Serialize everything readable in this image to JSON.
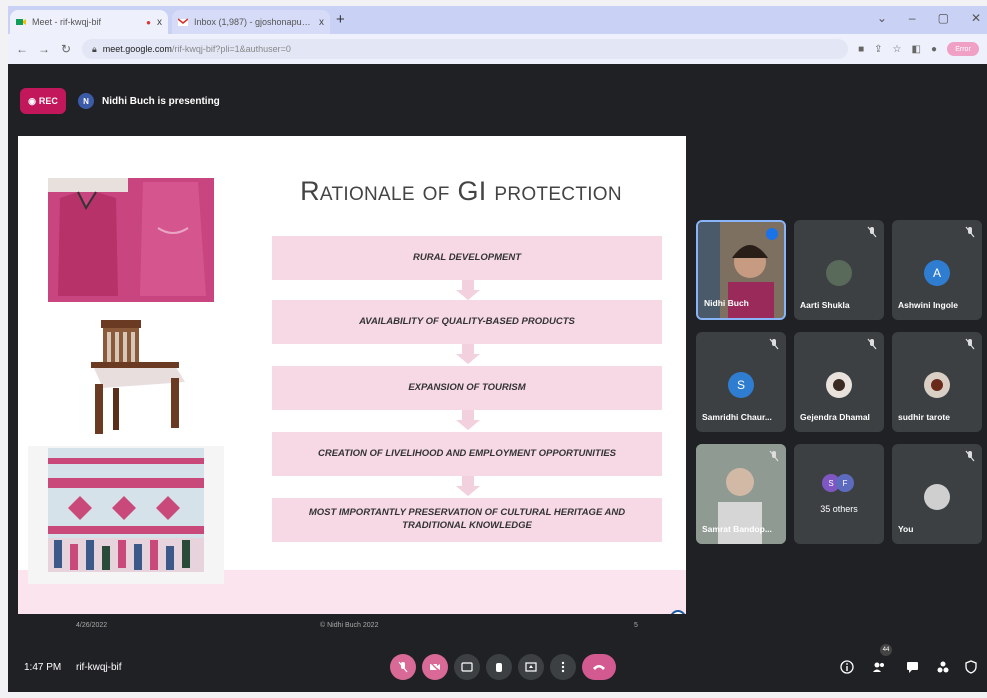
{
  "browser": {
    "tabs": [
      {
        "title": "Meet - rif-kwqj-bif",
        "recording": "●",
        "close": "x"
      },
      {
        "title": "Inbox (1,987) - gjoshonapune@...",
        "close": "x"
      }
    ],
    "new_tab": "+",
    "address": {
      "host": "meet.google.com",
      "path": "/rif-kwqj-bif?pli=1&authuser=0"
    },
    "profile_label": "Error"
  },
  "meet": {
    "rec_label": "REC",
    "presenter_initial": "N",
    "presenting_text": "Nidhi Buch is presenting",
    "slide": {
      "title": "Rationale of GI protection",
      "steps": [
        "RURAL DEVELOPMENT",
        "AVAILABILITY OF QUALITY-BASED PRODUCTS",
        "EXPANSION OF TOURISM",
        "CREATION OF LIVELIHOOD AND EMPLOYMENT OPPORTUNITIES",
        "MOST IMPORTANTLY PRESERVATION OF CULTURAL HERITAGE AND TRADITIONAL KNOWLEDGE"
      ],
      "footer_date": "4/26/2022",
      "footer_copyright": "© Nidhi Buch 2022",
      "footer_page": "5"
    },
    "participants": [
      {
        "name": "Nidhi Buch"
      },
      {
        "name": "Aarti Shukla"
      },
      {
        "name": "Ashwini Ingole",
        "initial": "A"
      },
      {
        "name": "Samridhi Chaur...",
        "initial": "S"
      },
      {
        "name": "Gejendra Dhamal"
      },
      {
        "name": "sudhir tarote"
      },
      {
        "name": "Samrat Bandop..."
      },
      {
        "name": "35 others",
        "initials": [
          "S",
          "F"
        ]
      },
      {
        "name": "You"
      }
    ],
    "bottom": {
      "time": "1:47 PM",
      "code": "rif-kwqj-bif",
      "people_count": "44"
    },
    "colors": {
      "rec": "#c2185b",
      "slide_band": "#fbe4ee",
      "step_fill": "#f6d9e5",
      "active_border": "#8ab4f8"
    }
  }
}
